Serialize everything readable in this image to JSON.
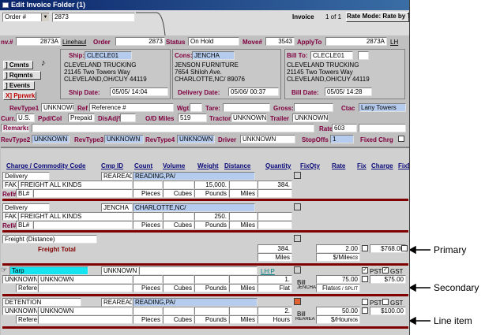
{
  "window": {
    "title": "Edit Invoice Folder (1)"
  },
  "toolbar": {
    "search_field": "Order #",
    "search_value": "2873",
    "invoice_label": "Invoice",
    "invoice_counter": "1 of 1",
    "rate_mode": "Rate Mode: Rate by Total"
  },
  "header": {
    "inv_label": "nv.#",
    "inv_value": "2873A",
    "linehaul": "Linehaul",
    "order_label": "Order",
    "order_value": "2873",
    "status_label": "Status",
    "status_value": "On Hold",
    "move_label": "Move#",
    "move_value": "3543",
    "apply_label": "ApplyTo",
    "apply_value": "2873A",
    "lh": "LH"
  },
  "side_buttons": [
    "] Cmnts",
    "] Rqmnts",
    "] Events",
    "X] Pprwrk"
  ],
  "icons": {
    "note": "♪",
    "hand": "☞"
  },
  "ship": {
    "label": "Ship:",
    "code": "CLECLE01",
    "name": "CLEVELAND TRUCKING",
    "address": "21145 Two Towers Way",
    "city": "CLEVELAND,OH/CUY 44119",
    "date_label": "Ship Date:",
    "date": "05/05/ 14:04"
  },
  "cons": {
    "label": "Cons:",
    "code": "JENCHA",
    "name": "JENSON FURNITURE",
    "address": "7654 Shiloh Ave.",
    "city": "CHARLOTTE,NC/ 89076",
    "date_label": "Delivery Date:",
    "date": "05/06/ 00:37"
  },
  "bill": {
    "label": "Bill To:",
    "code": "CLECLE01",
    "name": "CLEVELAND TRUCKING",
    "address": "21145 Two Towers Way",
    "city": "CLEVELAND,OH/CUY 44119",
    "date_label": "Bill Date:",
    "date": "05/05/ 14:28"
  },
  "rev": {
    "t1_label": "RevType1",
    "t1": "UNKNOWN",
    "ref_label": "Ref",
    "ref": "Reference #",
    "wgt_label": "Wgt",
    "tare_label": "Tare:",
    "gross_label": "Gross:",
    "ctac_label": "Ctac",
    "ctac": "Lany Towers"
  },
  "cur": {
    "label": "Curr.",
    "value": "U.S.",
    "ppd_label": "Ppd/Col",
    "ppd": "Prepaid",
    "disadj_label": "DisAdj%",
    "od_label": "O/D Miles",
    "od": "519",
    "tractor_label": "Tractor",
    "tractor": "UNKNOWN",
    "trailer_label": "Trailer",
    "trailer": "UNKNOWN"
  },
  "remarks": {
    "label": "Remarks",
    "rate_label": "Rate:",
    "rate": "603"
  },
  "rev2": {
    "t2_label": "RevType2",
    "t2": "UNKNOWN",
    "t3_label": "RevType3",
    "t3": "UNKNOWN",
    "t4_label": "RevType4",
    "t4": "UNKNOWN",
    "driver_label": "Driver",
    "driver": "UNKNOWN",
    "stop_label": "StopOffs",
    "stop": "1",
    "fixed_label": "Fixed Chrg"
  },
  "columns": [
    "Charge / Commodity Code",
    "Cmp ID",
    "Count",
    "Volume",
    "Weight",
    "Distance",
    "Quantity",
    "FixQty",
    "Rate",
    "Fix",
    "Charge",
    "Fix$"
  ],
  "units": {
    "count": "Pieces",
    "volume": "Cubes",
    "weight": "Pounds",
    "distance": "Miles"
  },
  "stops": [
    {
      "type": "Delivery",
      "company": "REAREA01",
      "city": "READING,PA/",
      "cmd": "FAK",
      "desc": "FREIGHT ALL KINDS",
      "weight": "15,000.",
      "qty": "384.",
      "ref_label": "Ref#:",
      "ref_type": "BL#"
    },
    {
      "type": "Delivery",
      "company": "JENCHA",
      "city": "CHARLOTTE,NC/",
      "cmd": "FAK",
      "desc": "FREIGHT ALL KINDS",
      "weight": "250.",
      "ref_label": "Ref#:",
      "ref_type": "BL#"
    }
  ],
  "primary": {
    "type": "Freight (Distance)",
    "total_label": "Freight Total",
    "qty": "384.",
    "unit": "Miles",
    "rate": "2.00",
    "charge": "$768.00",
    "rate_unit": "$/Mile",
    "rate_code": "603"
  },
  "secondary": {
    "type": "Tarp",
    "company": "UNKNOWN",
    "lhp": "LH:P",
    "check": "✓",
    "pst": "PST",
    "gst": "GST",
    "cmd": "UNKNOWN",
    "desc": "UNKNOWN",
    "qty": "1.",
    "bill": "Bill",
    "rate": "75.00",
    "charge": "$75.00",
    "ref_label": "Reference #",
    "unit": "Flat",
    "bill_code": "JENCHA",
    "rate_unit": "Flat",
    "rate_code": "605 / SPLIT"
  },
  "line_item": {
    "type": "DETENTION",
    "company": "REAREA01",
    "city": "READING,PA/",
    "pst": "PST",
    "gst": "GST",
    "cmd": "UNKNOWN",
    "desc": "UNKNOWN",
    "qty": "2.",
    "bill": "Bill",
    "rate": "50.00",
    "charge": "$100.00",
    "ref_label": "Reference #",
    "unit": "Hours",
    "bill_code": "REAREA",
    "rate_unit": "$/Hour",
    "rate_code": "606"
  },
  "annotations": [
    "Primary",
    "Secondary",
    "Line item"
  ]
}
